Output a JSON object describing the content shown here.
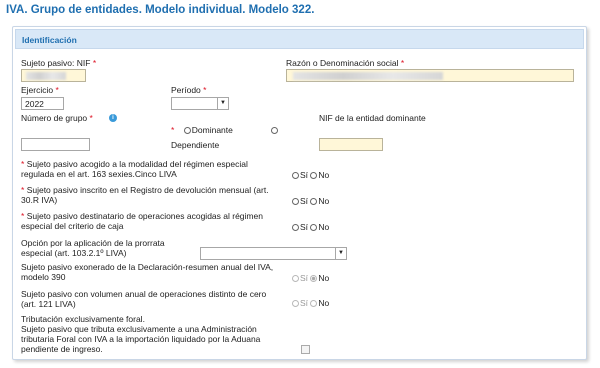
{
  "page": {
    "title": "IVA. Grupo de entidades. Modelo individual. Modelo 322."
  },
  "section": {
    "title": "Identificación"
  },
  "fields": {
    "sujeto_pasivo_nif": {
      "label": "Sujeto pasivo: NIF",
      "required": "*"
    },
    "razon_social": {
      "label": "Razón o Denominación social",
      "required": "*"
    },
    "ejercicio": {
      "label": "Ejercicio",
      "required": "*",
      "value": "2022"
    },
    "periodo": {
      "label": "Período",
      "required": "*",
      "value": ""
    },
    "numero_grupo": {
      "label": "Número de grupo",
      "required": "*",
      "info": "i"
    },
    "tipo_entidad": {
      "required": "*",
      "opt_dominante": "Dominante",
      "opt_dependiente": "Dependiente"
    },
    "nif_dominante": {
      "label": "NIF de la entidad dominante"
    }
  },
  "questions": [
    {
      "line1": "Sujeto pasivo acogido a la modalidad del régimen especial",
      "line2": "regulada en el art. 163 sexies.Cinco LIVA",
      "required": "*",
      "yes": "Sí",
      "no": "No"
    },
    {
      "line1": "Sujeto pasivo inscrito en el Registro de devolución mensual (art.",
      "line2": "30.R IVA)",
      "required": "*",
      "yes": "Sí",
      "no": "No"
    },
    {
      "line1": "Sujeto pasivo destinatario de operaciones acogidas al régimen",
      "line2": "especial del criterio de caja",
      "required": "*",
      "yes": "Sí",
      "no": "No"
    }
  ],
  "prorrata": {
    "line1": "Opción por la aplicación de la prorrata",
    "line2": "especial (art. 103.2.1º LIVA)",
    "value": ""
  },
  "exonerado": {
    "line1": "Sujeto pasivo exonerado de la Declaración-resumen anual del IVA,",
    "line2": "modelo 390",
    "yes": "Sí",
    "no": "No"
  },
  "volumen": {
    "line1": "Sujeto pasivo con volumen anual de operaciones distinto de cero",
    "line2": "(art. 121 LIVA)",
    "yes": "Sí",
    "no": "No"
  },
  "foral": {
    "line1": "Tributación exclusivamente foral.",
    "line2": "Sujeto pasivo que tributa exclusivamente a una Administración",
    "line3": "tributaria Foral con IVA a la importación liquidado por la Aduana",
    "line4": "pendiente de ingreso."
  }
}
